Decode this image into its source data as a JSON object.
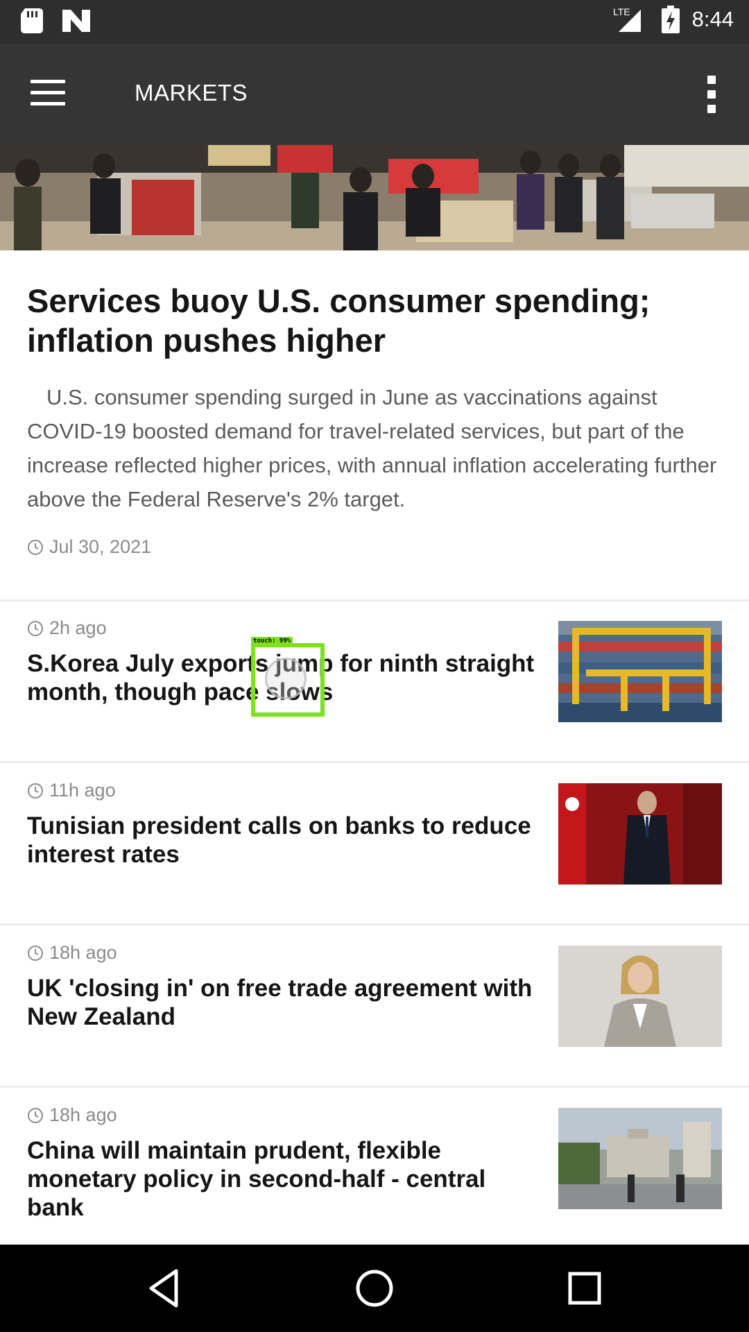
{
  "status_bar": {
    "time": "8:44",
    "network": "LTE"
  },
  "app_bar": {
    "title": "MARKETS"
  },
  "hero": {
    "title": "Services buoy U.S. consumer spending; inflation pushes higher",
    "summary": "U.S. consumer spending surged in June as vaccinations against COVID-19 boosted demand for travel-related services, but part of the increase reflected higher prices, with annual inflation accelerating further above the Federal Reserve's 2% target.",
    "date": "Jul 30, 2021"
  },
  "articles": [
    {
      "time": "2h ago",
      "headline": "S.Korea July exports jump for ninth straight month, though pace slows"
    },
    {
      "time": "11h ago",
      "headline": "Tunisian president calls on banks to reduce interest rates"
    },
    {
      "time": "18h ago",
      "headline": "UK 'closing in' on free trade agreement with New Zealand"
    },
    {
      "time": "18h ago",
      "headline": "China will maintain prudent, flexible monetary policy in second-half - central bank"
    }
  ],
  "touch_overlay": {
    "label": "touch: 99%"
  },
  "colors": {
    "app_bar": "#353535",
    "status_bar": "#2e2e2e",
    "touch": "#7ee11c"
  }
}
